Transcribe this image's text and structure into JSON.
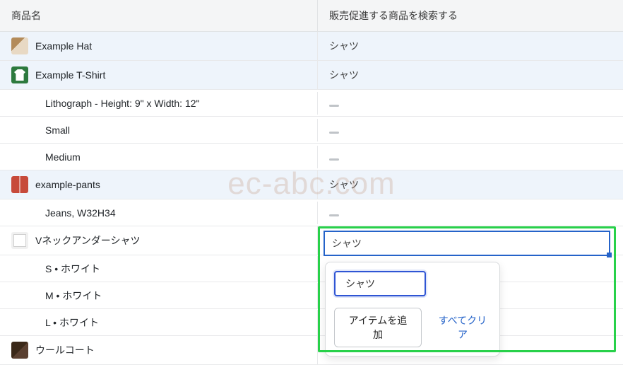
{
  "watermark": "ec-abc.com",
  "headers": {
    "name": "商品名",
    "search": "販売促進する商品を検索する"
  },
  "rows": [
    {
      "label": "Example Hat",
      "value": "シャツ",
      "thumb": "hat",
      "indent": false,
      "highlighted": true
    },
    {
      "label": "Example T-Shirt",
      "value": "シャツ",
      "thumb": "tshirt",
      "indent": false,
      "highlighted": true
    },
    {
      "label": "Lithograph - Height: 9\" x Width: 12\"",
      "value": "",
      "thumb": null,
      "indent": true,
      "highlighted": false
    },
    {
      "label": "Small",
      "value": "",
      "thumb": null,
      "indent": true,
      "highlighted": false
    },
    {
      "label": "Medium",
      "value": "",
      "thumb": null,
      "indent": true,
      "highlighted": false
    },
    {
      "label": "example-pants",
      "value": "シャツ",
      "thumb": "pants",
      "indent": false,
      "highlighted": true
    },
    {
      "label": "Jeans, W32H34",
      "value": "",
      "thumb": null,
      "indent": true,
      "highlighted": false
    },
    {
      "label": "Vネックアンダーシャツ",
      "value": "シャツ",
      "thumb": "vneck",
      "indent": false,
      "highlighted": false,
      "editing": true
    },
    {
      "label": "S • ホワイト",
      "value": "",
      "thumb": null,
      "indent": true,
      "highlighted": false
    },
    {
      "label": "M • ホワイト",
      "value": "",
      "thumb": null,
      "indent": true,
      "highlighted": false
    },
    {
      "label": "L • ホワイト",
      "value": "",
      "thumb": null,
      "indent": true,
      "highlighted": false
    },
    {
      "label": "ウールコート",
      "value": "",
      "thumb": "coat",
      "indent": false,
      "highlighted": false
    }
  ],
  "editor": {
    "input_value": "シャツ",
    "chip": "シャツ",
    "add_item": "アイテムを追加",
    "clear_all": "すべてクリア"
  }
}
